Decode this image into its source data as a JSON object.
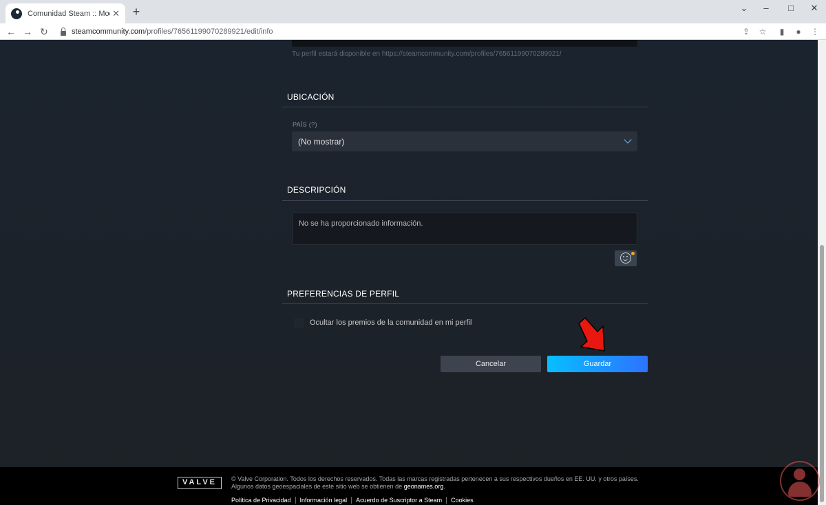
{
  "browser": {
    "tab_title": "Comunidad Steam :: Modificar p",
    "tab_close": "✕",
    "new_tab": "+",
    "url_host": "steamcommunity.com",
    "url_path": "/profiles/76561199070289921/edit/info",
    "nav": {
      "back": "←",
      "forward": "→",
      "reload": "↻"
    },
    "window": {
      "dropdown": "⌄",
      "minimize": "–",
      "maximize": "□",
      "close": "✕"
    },
    "tools": {
      "share": "⇪",
      "star": "☆",
      "sidebar": "▮",
      "profile": "●",
      "menu": "⋮"
    }
  },
  "profile_url_hint": "Tu perfil estará disponible en https://steamcommunity.com/profiles/76561199070289921/",
  "location": {
    "title": "UBICACIÓN",
    "country_label": "PAÍS (?)",
    "country_value": "(No mostrar)"
  },
  "description": {
    "title": "DESCRIPCIÓN",
    "text": "No se ha proporcionado información."
  },
  "preferences": {
    "title": "PREFERENCIAS DE PERFIL",
    "hide_awards_label": "Ocultar los premios de la comunidad en mi perfil",
    "hide_awards_checked": false
  },
  "actions": {
    "cancel": "Cancelar",
    "save": "Guardar"
  },
  "footer": {
    "logo": "VALVE",
    "legal_line1": "© Valve Corporation. Todos los derechos reservados. Todas las marcas registradas pertenecen a sus respectivos dueños en EE. UU. y otros países.",
    "legal_line2_prefix": "Algunos datos geoespaciales de este sitio web se obtienen de ",
    "legal_line2_link": "geonames.org",
    "legal_line2_suffix": ".",
    "links": [
      "Política de Privacidad",
      "Información legal",
      "Acuerdo de Suscriptor a Steam",
      "Cookies"
    ]
  },
  "colors": {
    "accent": "#66c0f4",
    "save_start": "#06bfff",
    "save_end": "#2d73ff",
    "arrow": "#e8170f"
  }
}
